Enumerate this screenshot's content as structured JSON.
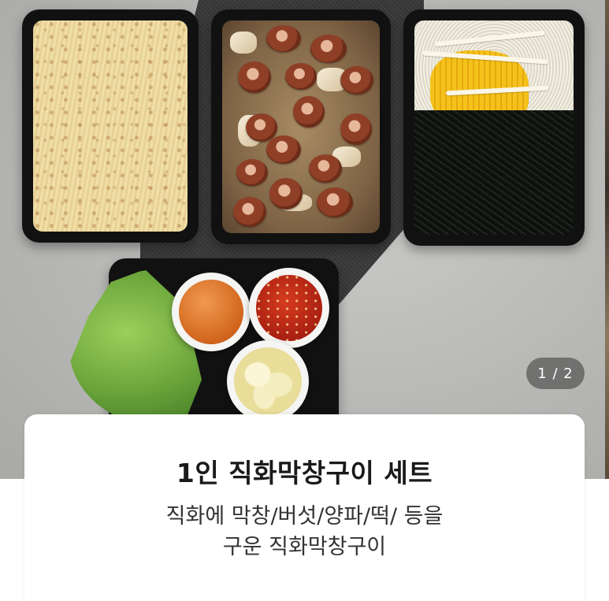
{
  "product": {
    "title": "1인 직화막창구이 세트",
    "description_lines": [
      "직화에 막창/버섯/양파/떡/ 등을",
      "구운 직화막창구이"
    ]
  },
  "gallery": {
    "page_indicator": "1 / 2",
    "current_page": 1,
    "total_pages": 2
  },
  "colors": {
    "background": "#ffffff",
    "indicator_bg": "#464646",
    "title_text": "#1a1a1a",
    "desc_text": "#333333"
  }
}
